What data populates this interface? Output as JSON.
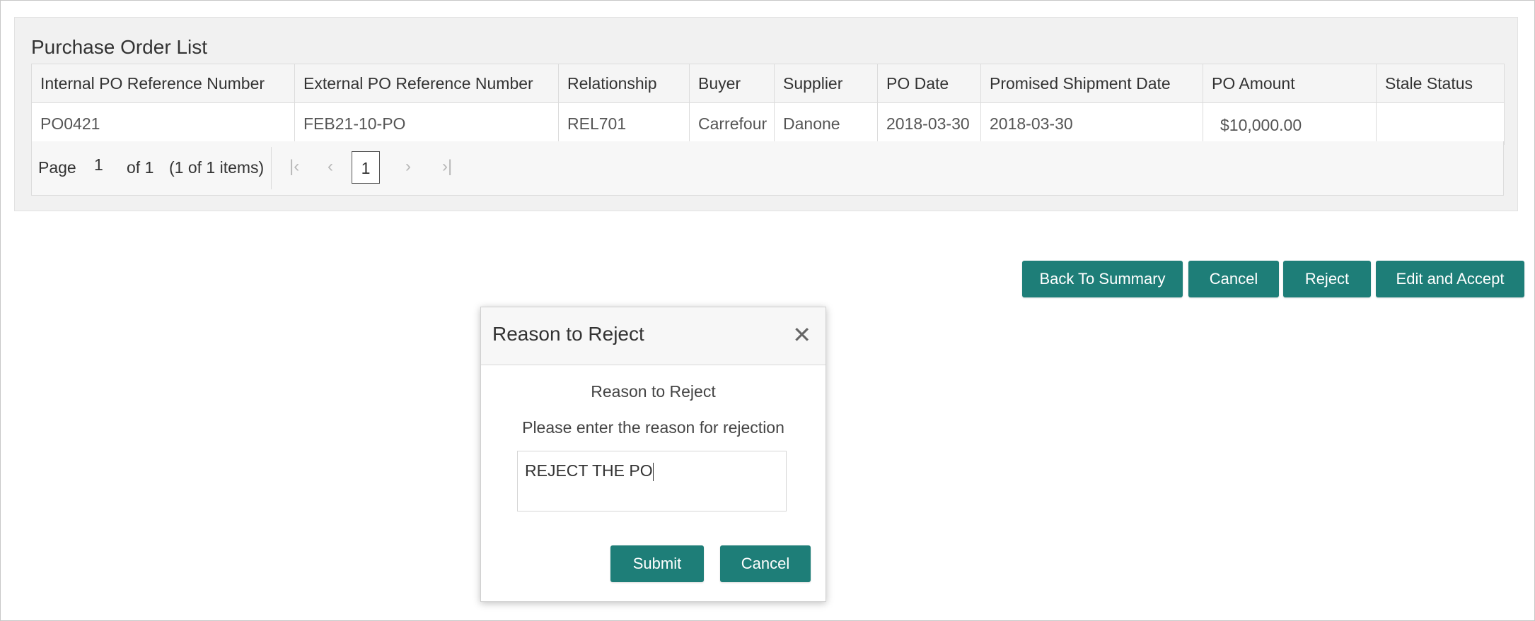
{
  "panel": {
    "title": "Purchase Order List",
    "columns": [
      "Internal PO Reference Number",
      "External PO Reference Number",
      "Relationship",
      "Buyer",
      "Supplier",
      "PO Date",
      "Promised Shipment Date",
      "PO Amount",
      "Stale Status"
    ],
    "rows": [
      [
        "PO0421",
        "FEB21-10-PO",
        "REL701",
        "Carrefour",
        "Danone",
        "2018-03-30",
        "2018-03-30",
        "$10,000.00",
        ""
      ]
    ]
  },
  "pager": {
    "page_label": "Page",
    "page_value": "1",
    "of_label": "of 1",
    "items_label": "(1 of 1 items)",
    "current": "1",
    "first_icon": "first-page-icon",
    "prev_icon": "prev-page-icon",
    "next_icon": "next-page-icon",
    "last_icon": "last-page-icon"
  },
  "actions": {
    "back": "Back To Summary",
    "cancel": "Cancel",
    "reject": "Reject",
    "edit_accept": "Edit and Accept"
  },
  "modal": {
    "title": "Reason to Reject",
    "close_icon": "close-icon",
    "label": "Reason to Reject",
    "prompt": "Please enter the reason for rejection",
    "reason_value": "REJECT THE PO",
    "submit": "Submit",
    "cancel": "Cancel"
  },
  "colors": {
    "accent": "#1e7e78"
  }
}
